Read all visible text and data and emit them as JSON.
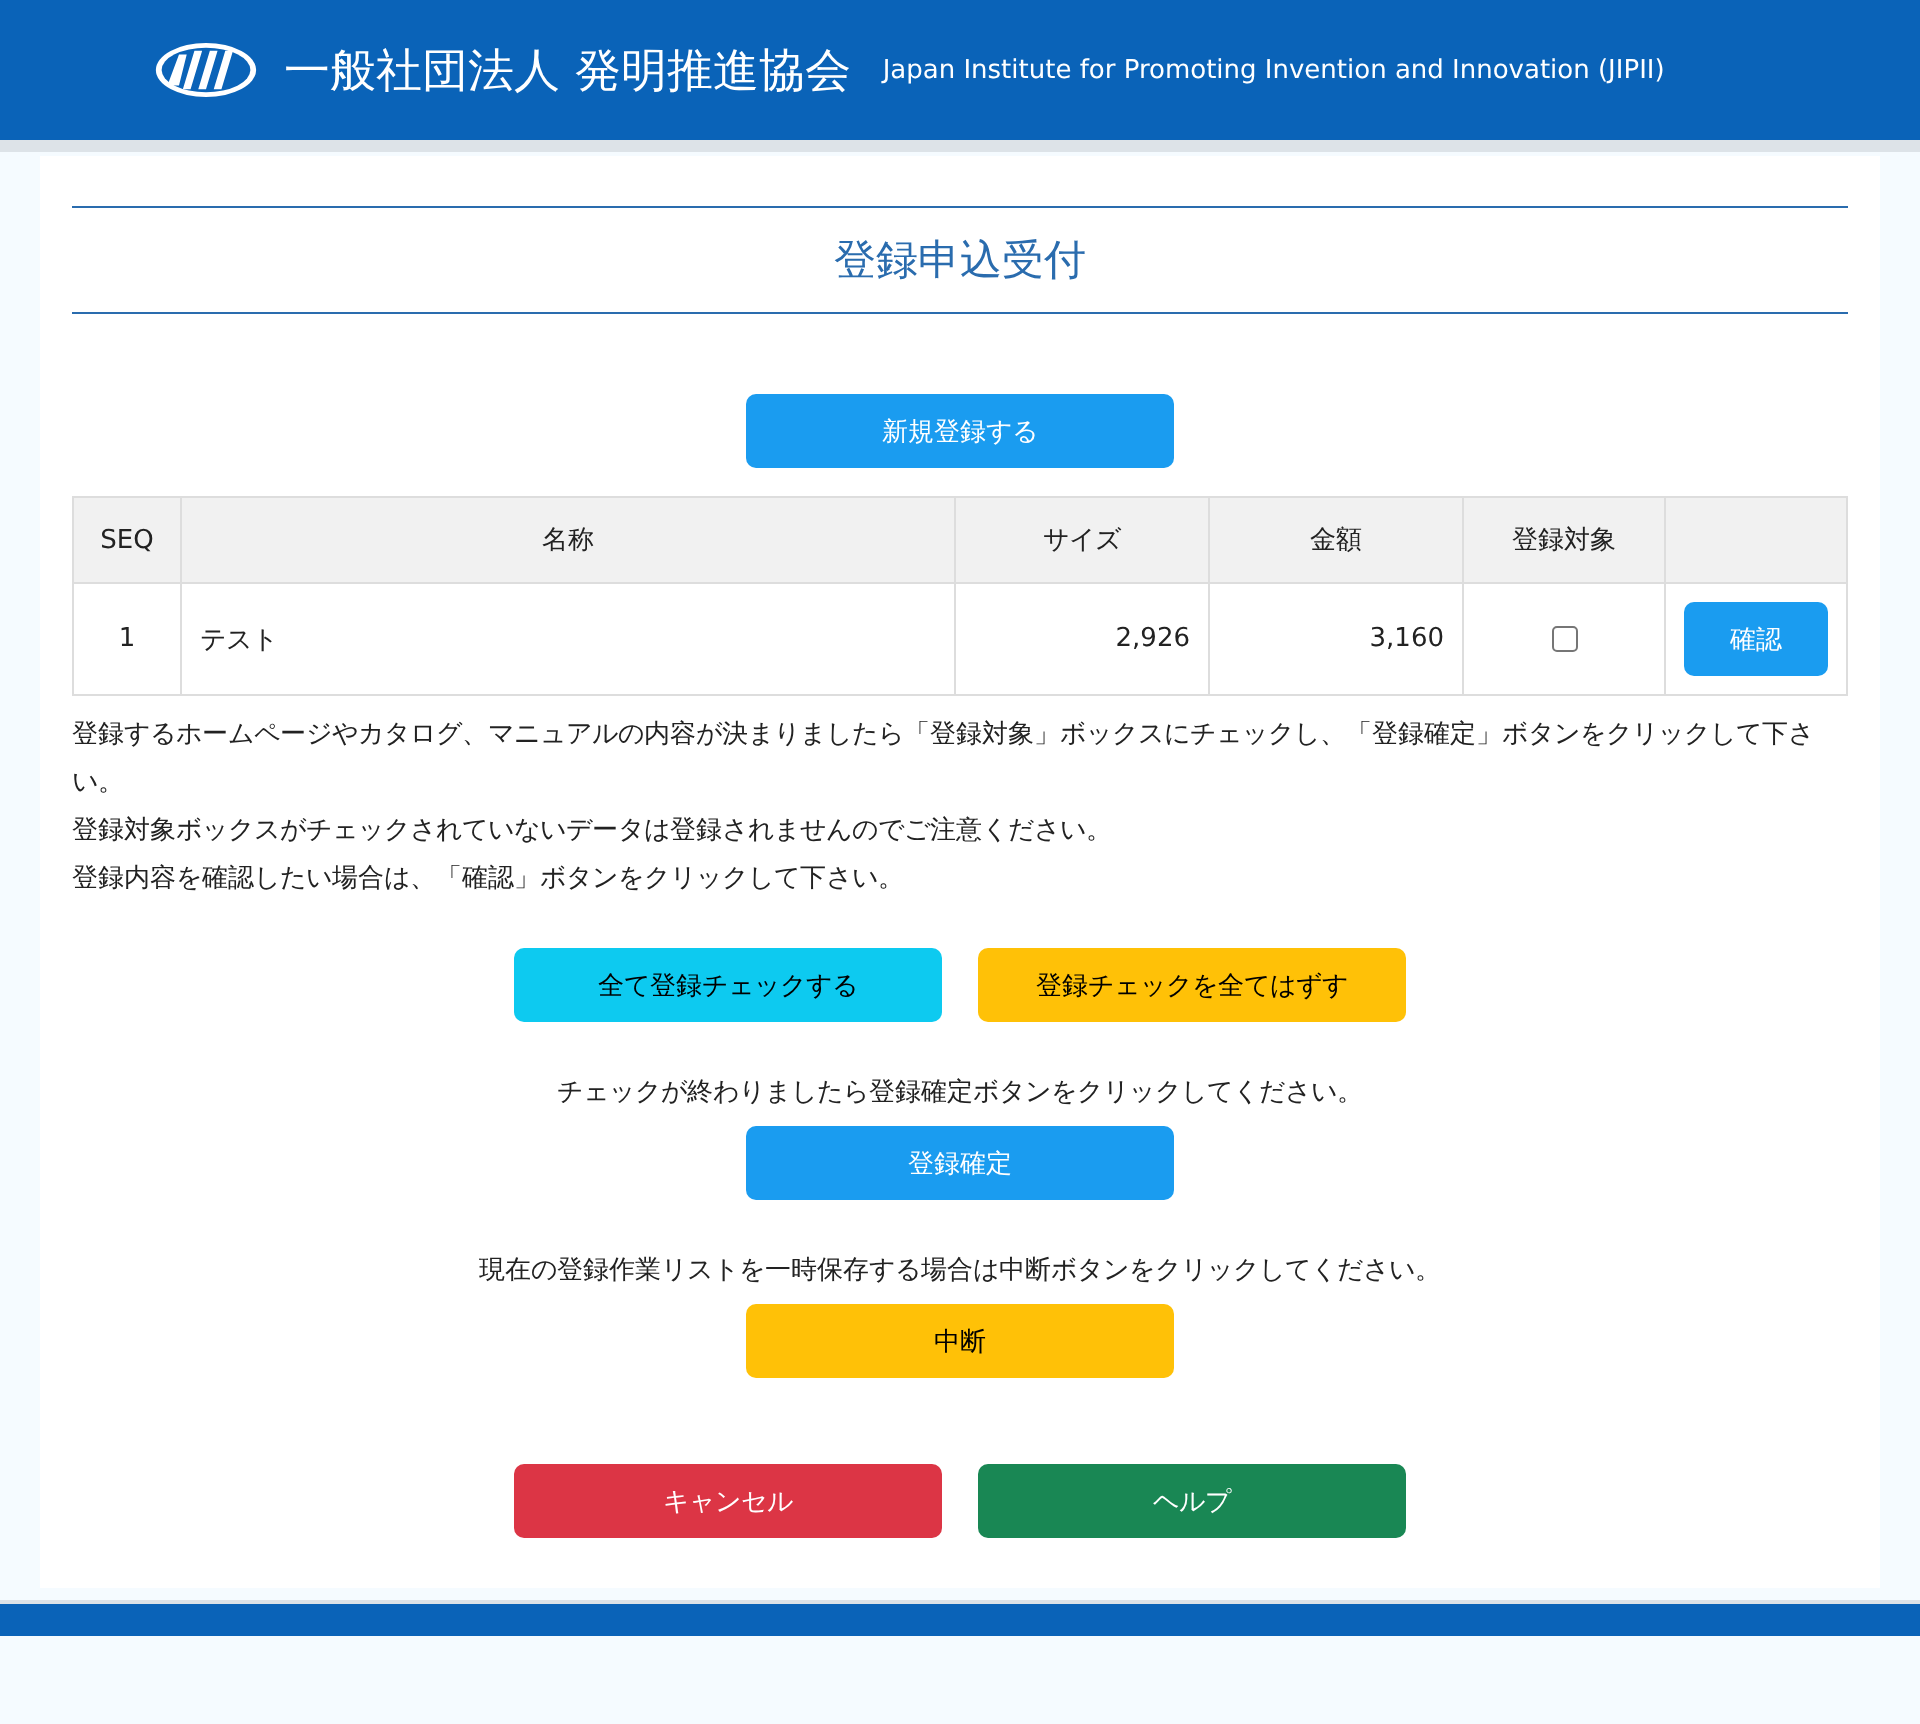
{
  "header": {
    "org_name": "一般社団法人 発明推進協会",
    "org_name_en": "Japan Institute for Promoting Invention and Innovation (JIPII)"
  },
  "page_title": "登録申込受付",
  "new_button": {
    "label": "新規登録する",
    "kind": "primary"
  },
  "table": {
    "columns": [
      "SEQ",
      "名称",
      "サイズ",
      "金額",
      "登録対象",
      ""
    ],
    "rows": [
      {
        "seq": "1",
        "name": "テスト",
        "size": "2,926",
        "amount": "3,160",
        "checked": false,
        "action": "確認"
      }
    ]
  },
  "notes": [
    "登録するホームページやカタログ、マニュアルの内容が決まりましたら「登録対象」ボックスにチェックし、「登録確定」ボタンをクリックして下さい。",
    "登録対象ボックスがチェックされていないデータは登録されませんのでご注意ください。",
    "登録内容を確認したい場合は、「確認」ボタンをクリックして下さい。"
  ],
  "check_buttons": [
    {
      "label": "全て登録チェックする",
      "kind": "info"
    },
    {
      "label": "登録チェックを全てはずす",
      "kind": "warning"
    }
  ],
  "confirm_hint": "チェックが終わりましたら登録確定ボタンをクリックしてください。",
  "confirm_button": {
    "label": "登録確定",
    "kind": "primary"
  },
  "suspend_hint": "現在の登録作業リストを一時保存する場合は中断ボタンをクリックしてください。",
  "suspend_button": {
    "label": "中断",
    "kind": "warning"
  },
  "bottom_buttons": [
    {
      "label": "キャンセル",
      "kind": "danger"
    },
    {
      "label": "ヘルプ",
      "kind": "success"
    }
  ]
}
